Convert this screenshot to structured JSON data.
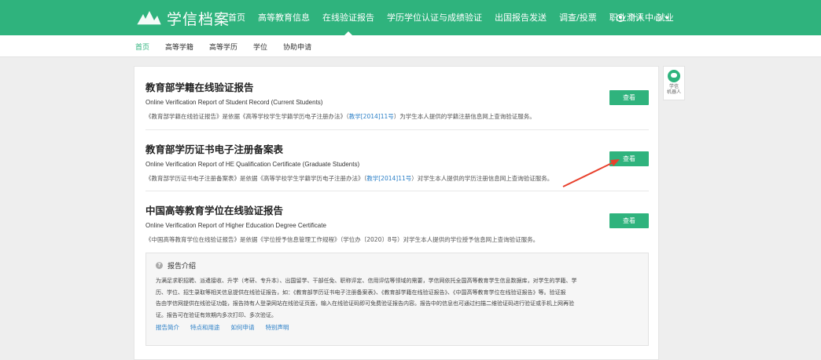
{
  "header": {
    "logo_text": "学信档案",
    "nav": [
      {
        "label": "首页"
      },
      {
        "label": "高等教育信息"
      },
      {
        "label": "在线验证报告",
        "active": true
      },
      {
        "label": "学历学位认证与成绩验证"
      },
      {
        "label": "出国报告发送"
      },
      {
        "label": "调查/投票"
      },
      {
        "label": "职业测评"
      },
      {
        "label": "就业"
      }
    ],
    "user_menu": "个人中心"
  },
  "subnav": [
    "首页",
    "高等学籍",
    "高等学历",
    "学位",
    "协助申请"
  ],
  "reports": [
    {
      "title": "教育部学籍在线验证报告",
      "subtitle": "Online Verification Report of Student Record (Current Students)",
      "desc_pre": "《教育部学籍在线验证报告》是依据《高等学校学生学籍学历电子注册办法》（",
      "desc_link": "教学[2014]11号",
      "desc_post": "）为学生本人提供的学籍注册信息网上查询验证服务。",
      "button": "查看"
    },
    {
      "title": "教育部学历证书电子注册备案表",
      "subtitle": "Online Verification Report of HE Qualification Certificate (Graduate Students)",
      "desc_pre": "《教育部学历证书电子注册备案表》是依据《高等学校学生学籍学历电子注册办法》（",
      "desc_link": "教学[2014]11号",
      "desc_post": "）对学生本人提供的学历注册信息网上查询验证服务。",
      "button": "查看"
    },
    {
      "title": "中国高等教育学位在线验证报告",
      "subtitle": "Online Verification Report of Higher Education Degree Certificate",
      "desc_pre": "《中国高等教育学位在线验证报告》是依据《学位授予信息管理工作规程》（学位办〔2020〕8号）对学生本人提供的学位授予信息网上查询验证服务。",
      "desc_link": "",
      "desc_post": "",
      "button": "查看"
    }
  ],
  "intro": {
    "title": "报告介绍",
    "body_lines": [
      "为满足求职招聘、派遣接收、升学（考研、专升本）、出国留学、干部任免、职称评定、信用评估等领域的需要，学信网依托全国高等教育学生信息数据库，对学生的学籍、学",
      "历、学位、招生录取等相关信息提供在线验证报告，如：《教育部学历证书电子注册备案表》、《教育部学籍在线验证报告》、《中国高等教育学位在线验证报告》等。验证报",
      "告由学信网提供在线验证功能，报告持有人登录网站在线验证页面，输入在线验证码即可免费验证报告内容。报告中的信息也可通过扫描二维验证码进行验证或手机上网再验",
      "证。报告可在验证有效期内多次打印、多次验证。"
    ],
    "links": [
      "报告简介",
      "特点和用途",
      "如何申请",
      "特别声明"
    ]
  },
  "side_widget": {
    "line1": "学信",
    "line2": "机器人"
  },
  "colors": {
    "brand": "#2fb37d",
    "link": "#2a7fc7",
    "arrow": "#e8402c"
  }
}
